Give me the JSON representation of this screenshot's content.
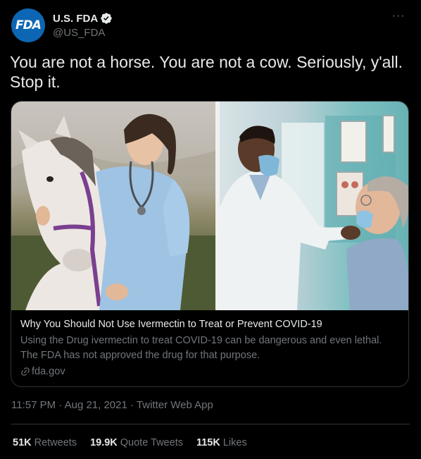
{
  "author": {
    "avatar_text": "FDA",
    "display_name": "U.S. FDA",
    "handle": "@US_FDA",
    "verified_icon": "verified-badge-icon"
  },
  "tweet": {
    "text": "You are not a horse. You are not a cow. Seriously, y'all. Stop it."
  },
  "card": {
    "title": "Why You Should Not Use Ivermectin to Treat or Prevent COVID-19",
    "description": "Using the Drug ivermectin to treat COVID-19 can be dangerous and even lethal. The FDA has not approved the drug for that purpose.",
    "domain": "fda.gov"
  },
  "meta": {
    "timestamp": "11:57 PM · Aug 21, 2021 · Twitter Web App"
  },
  "stats": [
    {
      "count": "51K",
      "label": "Retweets"
    },
    {
      "count": "19.9K",
      "label": "Quote Tweets"
    },
    {
      "count": "115K",
      "label": "Likes"
    }
  ],
  "colors": {
    "background": "#000000",
    "text_primary": "#e7e9ea",
    "text_secondary": "#71767b",
    "border": "#2f3336",
    "verified": "#e7e9ea",
    "avatar_bg": "#0d66b3"
  }
}
